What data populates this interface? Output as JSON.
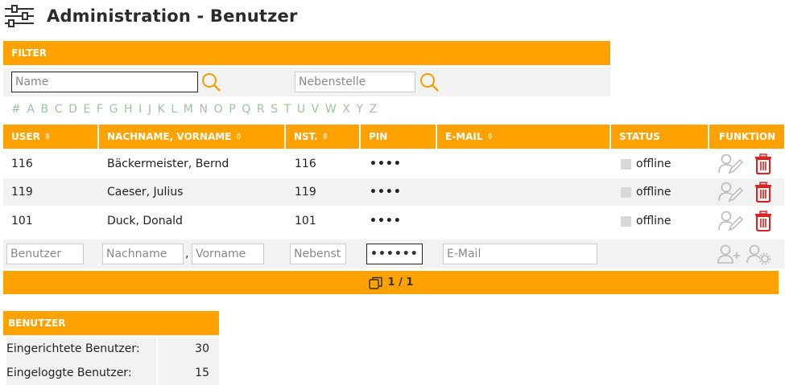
{
  "header": {
    "title": "Administration - Benutzer",
    "icon": "sliders-icon"
  },
  "filter": {
    "heading": "FILTER",
    "name_placeholder": "Name",
    "extension_placeholder": "Nebenstelle",
    "alphabet": [
      "#",
      "A",
      "B",
      "C",
      "D",
      "E",
      "F",
      "G",
      "H",
      "I",
      "J",
      "K",
      "L",
      "M",
      "N",
      "O",
      "P",
      "Q",
      "R",
      "S",
      "T",
      "U",
      "V",
      "W",
      "X",
      "Y",
      "Z"
    ]
  },
  "table": {
    "columns": {
      "user": "USER",
      "name": "NACHNAME, VORNAME",
      "ext": "NST.",
      "pin": "PIN",
      "email": "E-MAIL",
      "status": "STATUS",
      "function": "FUNKTION"
    },
    "sort_glyph": "⇳",
    "rows": [
      {
        "user": "116",
        "name": "Bäckermeister, Bernd",
        "ext": "116",
        "pin": "••••",
        "email": "",
        "status": "offline"
      },
      {
        "user": "119",
        "name": "Caeser, Julius",
        "ext": "119",
        "pin": "••••",
        "email": "",
        "status": "offline"
      },
      {
        "user": "101",
        "name": "Duck, Donald",
        "ext": "101",
        "pin": "••••",
        "email": "",
        "status": "offline"
      }
    ],
    "new_row": {
      "user_placeholder": "Benutzer",
      "lastname_placeholder": "Nachname",
      "comma": ",",
      "firstname_placeholder": "Vorname",
      "ext_placeholder": "Nebenst",
      "pin_value": "••••••",
      "email_placeholder": "E-Mail"
    }
  },
  "pager": {
    "text": "1 / 1"
  },
  "summary": {
    "heading": "BENUTZER",
    "rows": [
      {
        "label": "Eingerichtete Benutzer:",
        "value": "30"
      },
      {
        "label": "Eingeloggte Benutzer:",
        "value": "15"
      }
    ]
  },
  "colors": {
    "accent": "#ffa200",
    "delete": "#e02020",
    "alpha": "#9dc59d",
    "row_alt": "#f2f2f2"
  }
}
